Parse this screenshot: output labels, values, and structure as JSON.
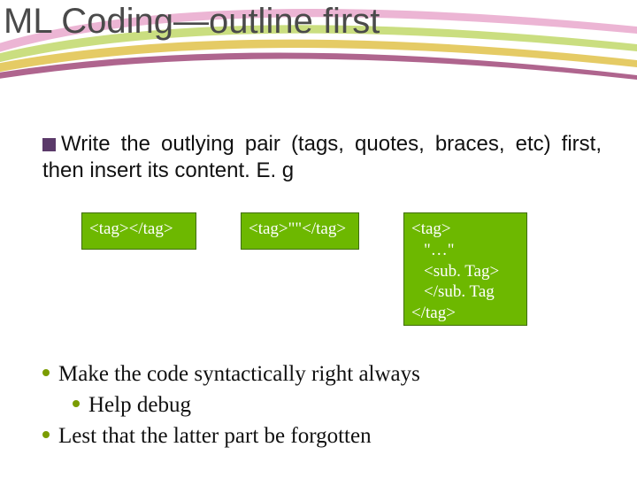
{
  "slide": {
    "title": "ML Coding—outline first",
    "point_main": "Write the outlying pair (tags, quotes, braces, etc) first, then insert its content. E. g",
    "code_boxes": {
      "box1": "<tag></tag>",
      "box2": "<tag>\"\"</tag>",
      "box3": {
        "l1": "<tag>",
        "l2": "\"…\"",
        "l3": "<sub. Tag>",
        "l4": "</sub. Tag",
        "l5": "</tag>"
      }
    },
    "notes": {
      "n1": "Make the code syntactically right always",
      "n1a": "Help debug",
      "n2": "Lest that the latter part be forgotten"
    }
  }
}
